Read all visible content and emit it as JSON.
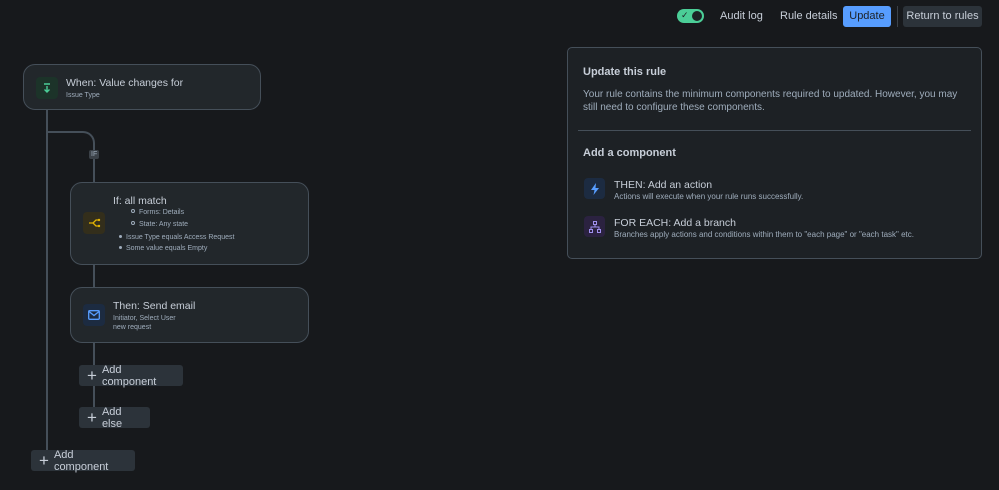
{
  "toolbar": {
    "toggle_enabled": true,
    "audit_log": "Audit log",
    "rule_details": "Rule details",
    "update": "Update",
    "return_to_rules": "Return to rules"
  },
  "flow": {
    "trigger": {
      "title": "When: Value changes for",
      "subtitle": "Issue Type",
      "icon": "trigger-icon"
    },
    "if_tag": "IF",
    "condition": {
      "title": "If: all match",
      "icon": "branch-condition-icon",
      "items": [
        {
          "text": "Forms: Details",
          "level": 2
        },
        {
          "text": "State: Any state",
          "level": 2
        },
        {
          "text": "Issue Type equals Access Request",
          "level": 1
        },
        {
          "text": "Some value equals Empty",
          "level": 1
        }
      ]
    },
    "action": {
      "title": "Then: Send email",
      "line1": "Initiator, Select User",
      "line2": "new request",
      "icon": "mail-icon"
    },
    "add_component_inner": "Add component",
    "add_else": "Add else",
    "add_component_outer": "Add component"
  },
  "panel": {
    "title": "Update this rule",
    "description": "Your rule contains the minimum components required to updated. However, you may still need to configure these components.",
    "add_heading": "Add a component",
    "options": [
      {
        "title": "THEN: Add an action",
        "desc": "Actions will execute when your rule runs successfully.",
        "icon": "lightning-icon"
      },
      {
        "title": "FOR EACH: Add a branch",
        "desc": "Branches apply actions and conditions within them to \"each page\" or \"each task\" etc.",
        "icon": "branch-icon"
      }
    ]
  },
  "colors": {
    "accent": "#579dff",
    "toggle": "#4bce97",
    "condition": "#e2b203",
    "branch": "#9f8fef"
  }
}
